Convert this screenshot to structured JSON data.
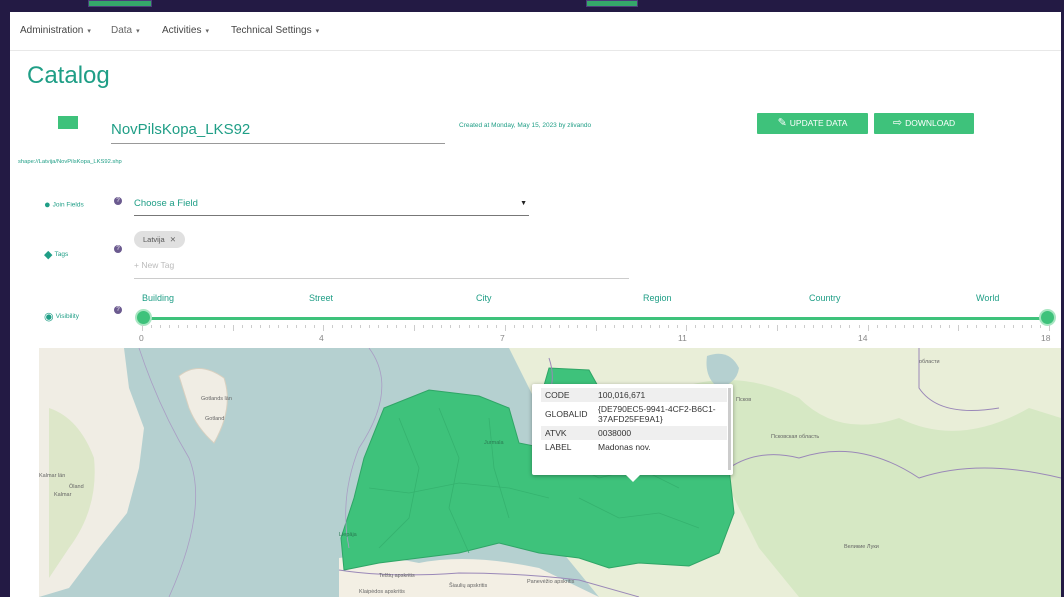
{
  "nav": {
    "items": [
      {
        "label": "Administration"
      },
      {
        "label": "Data"
      },
      {
        "label": "Activities"
      },
      {
        "label": "Technical Settings"
      }
    ],
    "caret": "▾"
  },
  "page": {
    "title": "Catalog"
  },
  "dataset": {
    "name": "NovPilsKopa_LKS92",
    "created": "Created at Monday, May 15, 2023 by zlivando",
    "path": "shape://Latvija/NovPilsKopa_LKS92.shp",
    "swatch_color": "#3ec27b"
  },
  "buttons": {
    "update": "UPDATE DATA",
    "download": "DOWNLOAD"
  },
  "join_fields": {
    "label": "Join Fields",
    "placeholder": "Choose a Field"
  },
  "tags": {
    "label": "Tags",
    "chips": [
      "Latvija"
    ],
    "new_placeholder": "+ New Tag"
  },
  "visibility": {
    "label": "Visibility",
    "levels": [
      "Building",
      "Street",
      "City",
      "Region",
      "Country",
      "World"
    ],
    "tick_labels": [
      "0",
      "4",
      "7",
      "11",
      "14",
      "18"
    ],
    "range": [
      0,
      18
    ]
  },
  "map": {
    "labels": {
      "gotland_lan": "Gotlands län",
      "gotland": "Gotland",
      "kalmar_lan": "Kalmar län",
      "oland": "Öland",
      "kalmar": "Kalmar",
      "jurmala": "Jurmala",
      "liepaja": "Liepāja",
      "telsiu": "Telšių apskritis",
      "siauliu": "Šiaulių apskritis",
      "panevezio": "Panevėžio apskritis",
      "klaipedos": "Klaipėdos apskritis",
      "pskov_oblast": "Псковская область",
      "velikie_luki": "Великие Луки",
      "pskov": "Псков",
      "oblast": "области"
    },
    "popup": {
      "rows": [
        {
          "key": "CODE",
          "value": "100,016,671"
        },
        {
          "key": "GLOBALID",
          "value": "{DE790EC5-9941-4CF2-B6C1-37AFD25FE9A1}"
        },
        {
          "key": "ATVK",
          "value": "0038000"
        },
        {
          "key": "LABEL",
          "value": "Madonas nov."
        }
      ]
    },
    "colors": {
      "water": "#b5d0d0",
      "land": "#f0ede4",
      "forest": "#d6e8c4",
      "latvia": "#3ec27b",
      "border": "#9a88b8"
    }
  }
}
